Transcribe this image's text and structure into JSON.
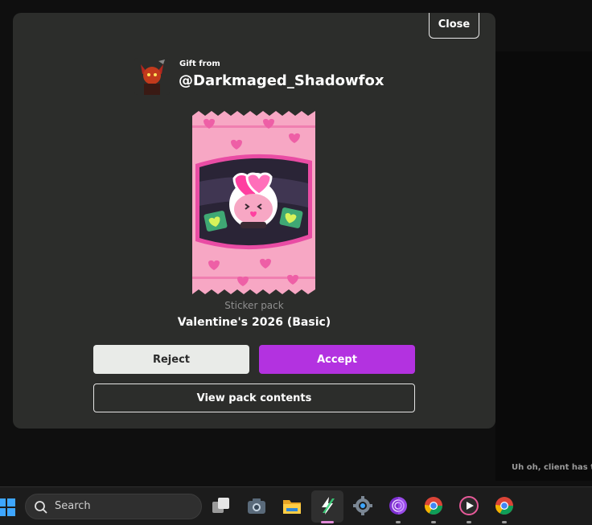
{
  "modal": {
    "close_label": "Close",
    "gift_label": "Gift from",
    "gift_user": "@Darkmaged_Shadowfox",
    "pack_type": "Sticker pack",
    "pack_name": "Valentine's 2026 (Basic)",
    "reject_label": "Reject",
    "accept_label": "Accept",
    "view_label": "View pack contents"
  },
  "background": {
    "notice": "Uh oh, client has tro"
  },
  "taskbar": {
    "search_label": "Search",
    "icons": [
      "windows-start-icon",
      "task-view-icon",
      "camera-icon",
      "file-explorer-icon",
      "bolt-app-icon",
      "settings-gear-icon",
      "tor-browser-icon",
      "chrome-icon",
      "media-player-icon",
      "chrome-icon"
    ]
  },
  "colors": {
    "accept": "#b332e0",
    "reject": "#e9ebe8",
    "modal_bg": "#2c2d2b",
    "pack_pink": "#f7a7c4"
  }
}
